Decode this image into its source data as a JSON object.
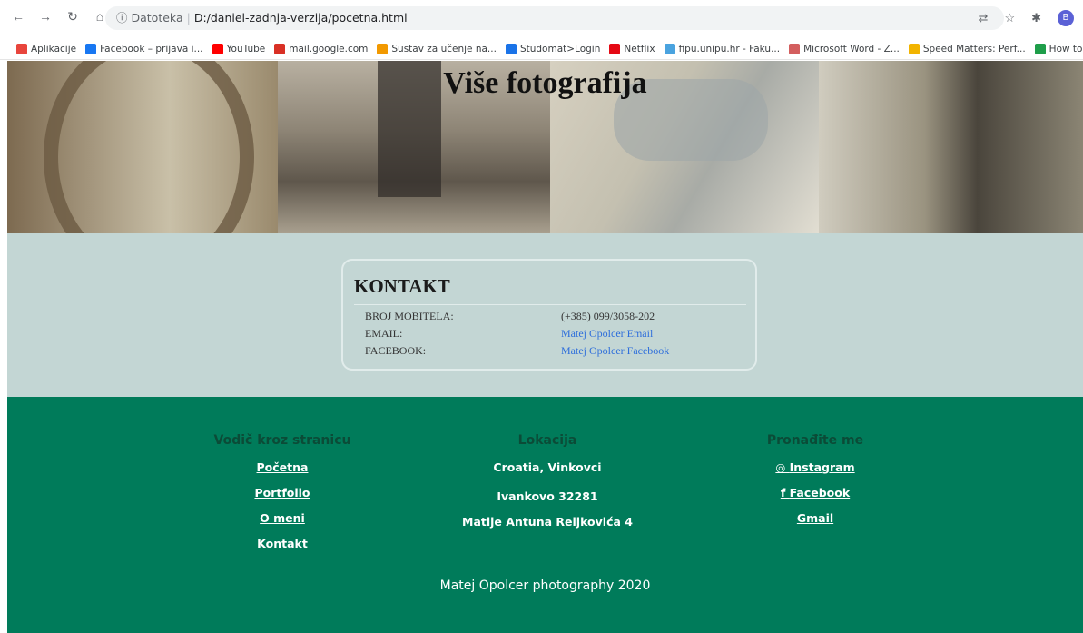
{
  "browser": {
    "secure_label": "Datoteka",
    "url": "D:/daniel-zadnja-verzija/pocetna.html",
    "avatar_letter": "B",
    "bookmarks": [
      {
        "label": "Aplikacije",
        "color": "#e8453c"
      },
      {
        "label": "Facebook – prijava i...",
        "color": "#1877f2"
      },
      {
        "label": "YouTube",
        "color": "#ff0000"
      },
      {
        "label": "mail.google.com",
        "color": "#d93025"
      },
      {
        "label": "Sustav za učenje na...",
        "color": "#f29900"
      },
      {
        "label": "Studomat>Login",
        "color": "#1a73e8"
      },
      {
        "label": "Netflix",
        "color": "#e50914"
      },
      {
        "label": "fipu.unipu.hr - Faku...",
        "color": "#4aa3df"
      },
      {
        "label": "Microsoft Word - Z...",
        "color": "#d35e5e"
      },
      {
        "label": "Speed Matters: Perf...",
        "color": "#f2b400"
      },
      {
        "label": "How to Analyze Yo...",
        "color": "#1e9e4a"
      }
    ]
  },
  "hero": {
    "title": "Više fotografija"
  },
  "contact": {
    "heading": "KONTAKT",
    "rows": [
      {
        "label": "BROJ MOBITELA:",
        "value": "(+385) 099/3058-202"
      },
      {
        "label": "EMAIL:",
        "value": "Matej Opolcer Email"
      },
      {
        "label": "FACEBOOK:",
        "value": "Matej Opolcer Facebook"
      }
    ]
  },
  "footer": {
    "col1": {
      "heading": "Vodič kroz stranicu",
      "items": [
        "Početna",
        "Portfolio",
        "O meni",
        "Kontakt"
      ]
    },
    "col2": {
      "heading": "Lokacija",
      "items": [
        "Croatia, Vinkovci",
        "Ivankovo 32281",
        "Matije Antuna Reljkovića 4"
      ]
    },
    "col3": {
      "heading": "Pronađite me",
      "items": [
        "Instagram",
        "Facebook",
        "Gmail"
      ]
    },
    "copyright": "Matej Opolcer photography 2020"
  }
}
